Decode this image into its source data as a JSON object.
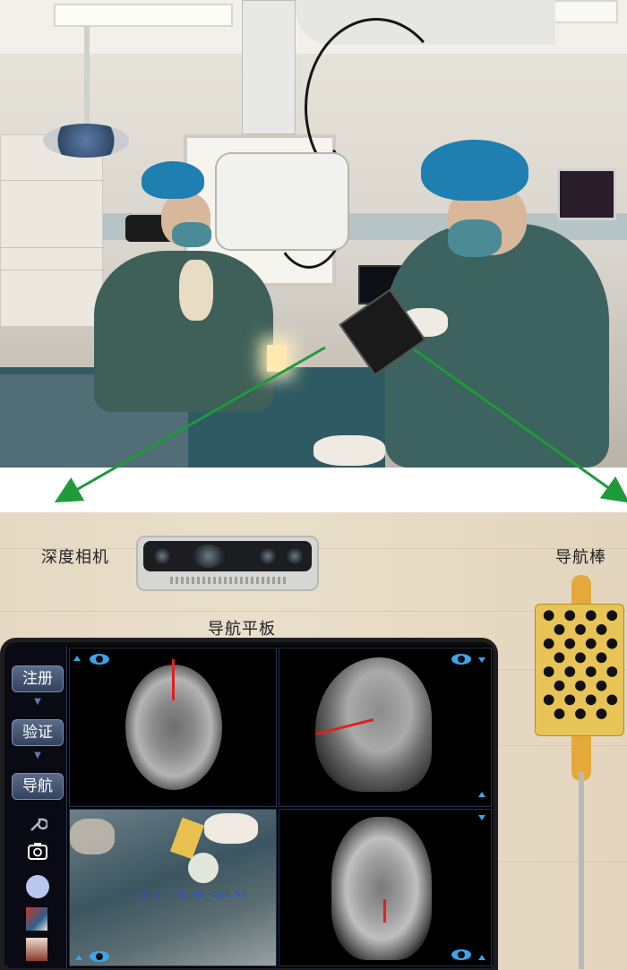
{
  "labels": {
    "depth_camera": "深度相机",
    "navigation_rod": "导航棒",
    "navigation_tablet": "导航平板"
  },
  "tablet_ui": {
    "sidebar_buttons": [
      "注册",
      "验证",
      "导航"
    ],
    "icons": [
      "wrench-icon",
      "refresh-camera-icon",
      "record-circle-icon"
    ],
    "video_overlay_text": "59.87 -40.08 -256.92"
  },
  "colors": {
    "arrow_green": "#1f9a3a",
    "probe_red": "#e02020",
    "ui_accent_blue": "#3aa6e8"
  }
}
